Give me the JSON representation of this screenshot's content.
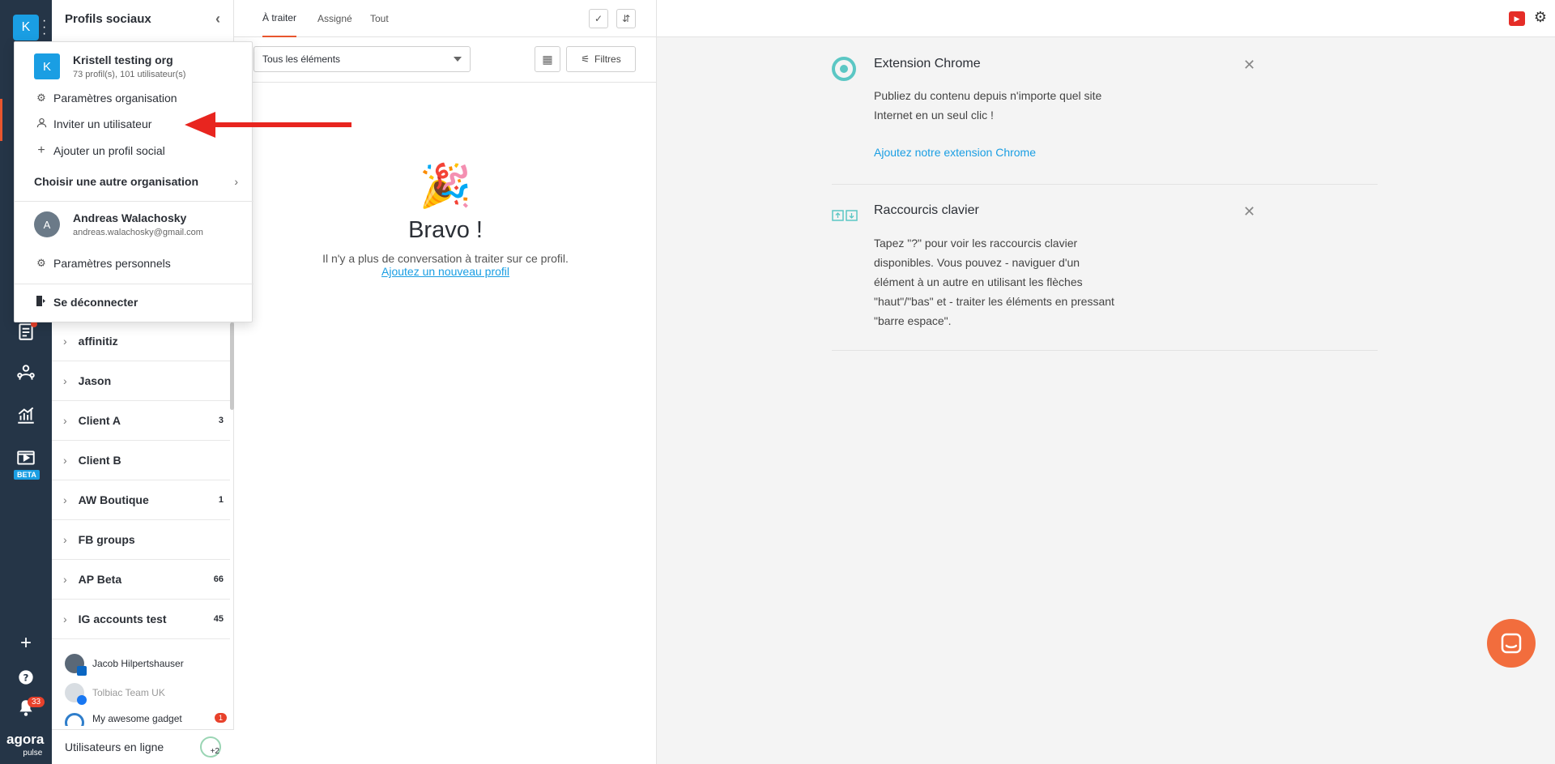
{
  "rail": {
    "org_initial": "K",
    "beta_label": "BETA",
    "notif_count": "33",
    "brand_top": "agora",
    "brand_bottom": "pulse"
  },
  "profiles": {
    "title": "Profils sociaux",
    "groups": [
      {
        "name": "affinitiz",
        "count": ""
      },
      {
        "name": "Jason",
        "count": ""
      },
      {
        "name": "Client A",
        "count": "3"
      },
      {
        "name": "Client B",
        "count": ""
      },
      {
        "name": "AW Boutique",
        "count": "1"
      },
      {
        "name": "FB groups",
        "count": ""
      },
      {
        "name": "AP Beta",
        "count": "66"
      },
      {
        "name": "IG accounts test",
        "count": "45"
      }
    ],
    "accounts": [
      {
        "name": "Jacob Hilpertshauser"
      },
      {
        "name": "Tolbiac Team UK"
      },
      {
        "name": "My awesome gadget",
        "badge": "1"
      }
    ],
    "online_label": "Utilisateurs en ligne",
    "online_extra": "+2"
  },
  "inbox": {
    "tabs": [
      "À traiter",
      "Assigné",
      "Tout"
    ],
    "select_value": "Tous les éléments",
    "filters_label": "Filtres",
    "empty_title": "Bravo !",
    "empty_text": "Il n'y a plus de conversation à traiter sur ce profil.",
    "empty_link": "Ajoutez un nouveau profil"
  },
  "cards": [
    {
      "title": "Extension Chrome",
      "body": "Publiez du contenu depuis n'importe quel site Internet en un seul clic !",
      "link": "Ajoutez notre extension Chrome"
    },
    {
      "title": "Raccourcis clavier",
      "body": "Tapez \"?\" pour voir les raccourcis clavier disponibles. Vous pouvez - naviguer d'un élément à un autre en utilisant les flèches \"haut\"/\"bas\" et - traiter les éléments en pressant \"barre espace\"."
    }
  ],
  "dropdown": {
    "org_initial": "K",
    "org_name": "Kristell testing org",
    "org_sub": "73 profil(s), 101 utilisateur(s)",
    "org_settings": "Paramètres organisation",
    "invite_user": "Inviter un utilisateur",
    "add_profile": "Ajouter un profil social",
    "choose_org": "Choisir une autre organisation",
    "user_initial": "A",
    "user_name": "Andreas Walachosky",
    "user_email": "andreas.walachosky@gmail.com",
    "personal_settings": "Paramètres personnels",
    "logout": "Se déconnecter"
  },
  "colors": {
    "accent": "#e8562e",
    "brand_blue": "#1a9ee3",
    "rail_bg": "#253547",
    "annotation_red": "#e8251f"
  }
}
